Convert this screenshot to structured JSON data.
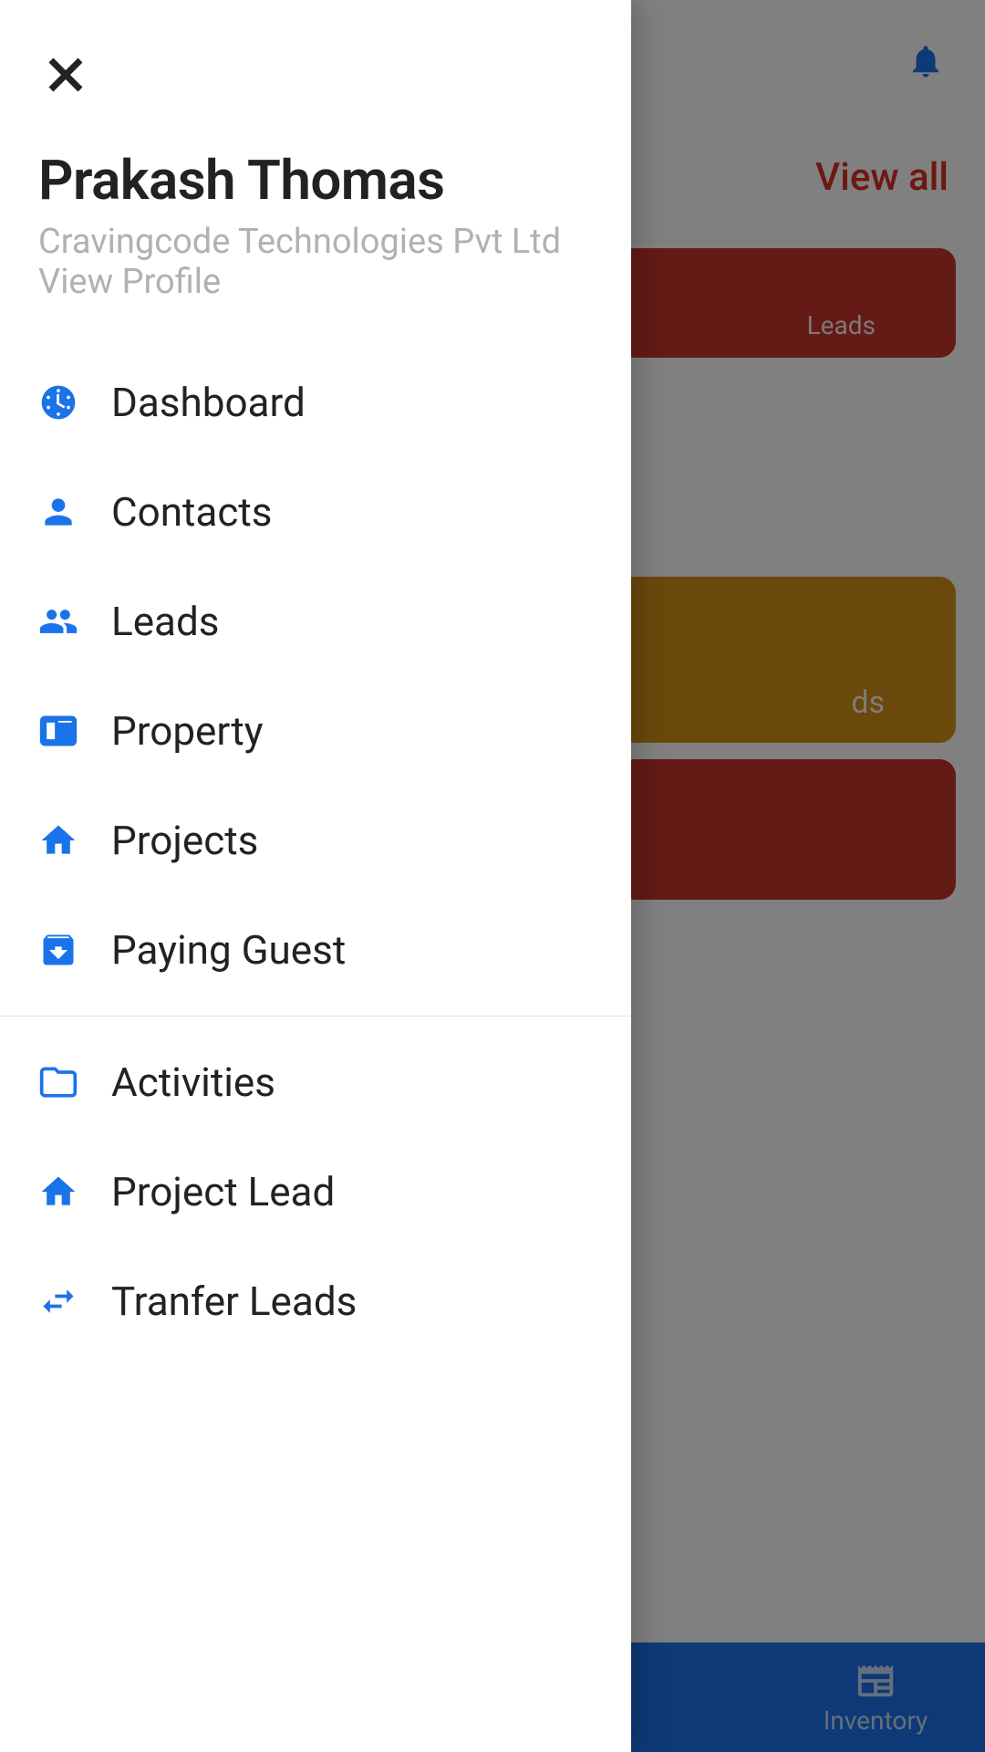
{
  "profile": {
    "name": "Prakash Thomas",
    "company": "Cravingcode Technologies Pvt Ltd",
    "view_profile": "View Profile"
  },
  "drawer": {
    "section1": [
      {
        "icon": "clock",
        "label": "Dashboard",
        "slug": "dashboard"
      },
      {
        "icon": "person",
        "label": "Contacts",
        "slug": "contacts"
      },
      {
        "icon": "people",
        "label": "Leads",
        "slug": "leads"
      },
      {
        "icon": "newspaper",
        "label": "Property",
        "slug": "property"
      },
      {
        "icon": "home",
        "label": "Projects",
        "slug": "projects"
      },
      {
        "icon": "archive",
        "label": "Paying Guest",
        "slug": "paying-guest"
      }
    ],
    "section2": [
      {
        "icon": "folder",
        "label": "Activities",
        "slug": "activities"
      },
      {
        "icon": "home",
        "label": "Project Lead",
        "slug": "project-lead"
      },
      {
        "icon": "transfer",
        "label": "Tranfer Leads",
        "slug": "transfer-leads"
      }
    ]
  },
  "background": {
    "view_all": "View all",
    "card1_sub": "Leads",
    "card2_sub": "ds",
    "bottom_nav_item": "Inventory"
  },
  "colors": {
    "accent": "#1a73e8",
    "red": "#c5342b",
    "orange": "#d28e18"
  }
}
